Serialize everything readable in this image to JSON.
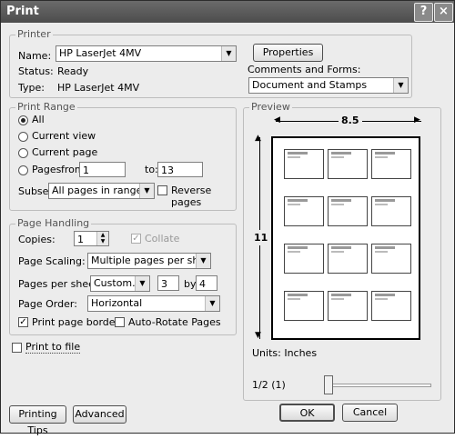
{
  "window": {
    "title": "Print"
  },
  "printer": {
    "legend": "Printer",
    "name_label": "Name:",
    "name_value": "HP LaserJet 4MV",
    "properties_label": "Properties",
    "status_label": "Status:",
    "status_value": "Ready",
    "type_label": "Type:",
    "type_value": "HP LaserJet 4MV",
    "comments_label": "Comments and Forms:",
    "comments_value": "Document and Stamps"
  },
  "print_range": {
    "legend": "Print Range",
    "all_label": "All",
    "current_view_label": "Current view",
    "current_page_label": "Current page",
    "pages_label": "Pages",
    "from_label": "from:",
    "from_value": "1",
    "to_label": "to:",
    "to_value": "13",
    "selected": "all",
    "subset_label": "Subset:",
    "subset_value": "All pages in range",
    "reverse_label": "Reverse pages",
    "reverse_checked": false
  },
  "page_handling": {
    "legend": "Page Handling",
    "copies_label": "Copies:",
    "copies_value": "1",
    "collate_label": "Collate",
    "collate_checked": true,
    "scaling_label": "Page Scaling:",
    "scaling_value": "Multiple pages per sheet",
    "pps_label": "Pages per sheet:",
    "pps_value": "Custom...",
    "pps_cols": "3",
    "by_label": "by",
    "pps_rows": "4",
    "order_label": "Page Order:",
    "order_value": "Horizontal",
    "border_label": "Print page border",
    "border_checked": true,
    "rotate_label": "Auto-Rotate Pages",
    "rotate_checked": false
  },
  "print_to_file": {
    "label": "Print to file",
    "checked": false
  },
  "preview": {
    "legend": "Preview",
    "width_label": "8.5",
    "height_label": "11",
    "units_label": "Units: Inches",
    "page_indicator": "1/2 (1)",
    "thumbnail_count": 12
  },
  "buttons": {
    "printing_tips": "Printing Tips",
    "advanced": "Advanced",
    "ok": "OK",
    "cancel": "Cancel"
  }
}
